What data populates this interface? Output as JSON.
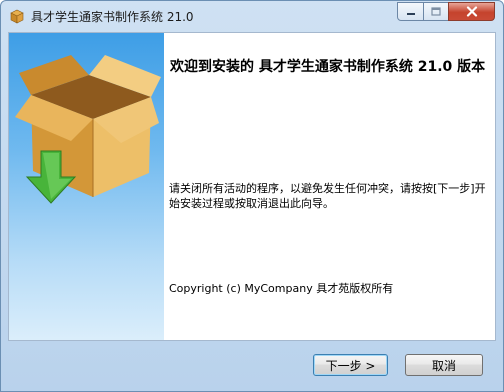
{
  "window": {
    "title": "具才学生通家书制作系统 21.0"
  },
  "welcome": {
    "heading": "欢迎到安装的 具才学生通家书制作系统 21.0 版本",
    "body": "请关闭所有活动的程序，以避免发生任何冲突，请按按[下一步]开始安装过程或按取消退出此向导。",
    "copyright": "Copyright (c) MyCompany 具才苑版权所有"
  },
  "buttons": {
    "next_label": "下一步 >",
    "cancel_label": "取消"
  },
  "icons": {
    "app": "package-icon",
    "banner": "box-download-icon",
    "minimize": "minimize-icon",
    "maximize": "maximize-icon",
    "close": "close-icon"
  },
  "colors": {
    "banner_top": "#3e9ee6",
    "banner_bottom": "#dbeefb",
    "close_button": "#c5432d"
  }
}
